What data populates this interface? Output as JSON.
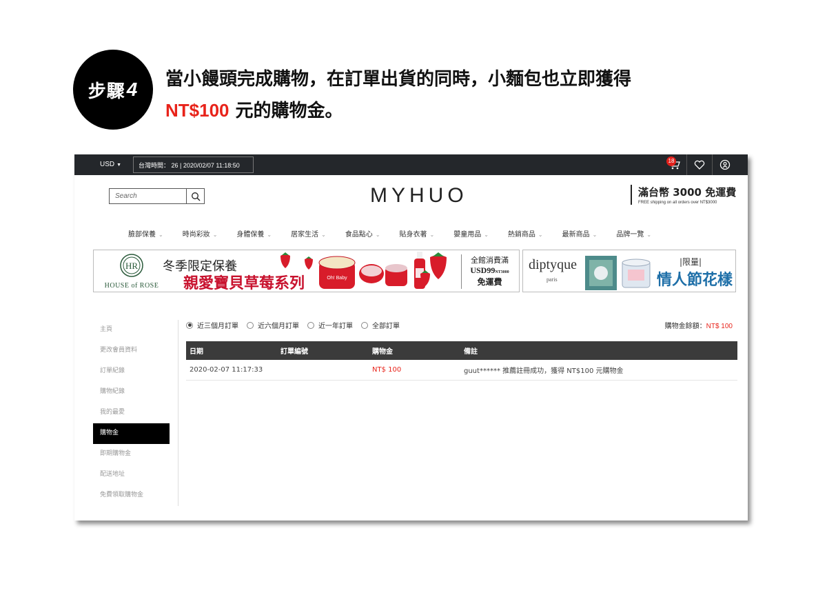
{
  "step": {
    "badge_text": "步驟",
    "badge_number": "4",
    "line1": "當小饅頭完成購物，在訂單出貨的同時，小麵包也立即獲得",
    "line2_highlight": "NT$100",
    "line2_rest": " 元的購物金。"
  },
  "topbar": {
    "currency": "USD",
    "clock": "台灣時間： 26 | 2020/02/07 11:18:50",
    "cart_count": "18",
    "icons": [
      "cart-icon",
      "heart-icon",
      "account-icon"
    ]
  },
  "header": {
    "search_placeholder": "Search",
    "logo": "MYHUO",
    "shipping_main": "滿台幣 3000 免運費",
    "shipping_sub": "FREE shipping on all orders over NT$3000"
  },
  "nav": {
    "items": [
      "臉部保養",
      "時尚彩妝",
      "身體保養",
      "居家生活",
      "食品點心",
      "貼身衣著",
      "嬰童用品",
      "熱銷商品",
      "最新商品",
      "品牌一覽"
    ]
  },
  "banners": {
    "house_rose": {
      "brand": "HOUSE of ROSE",
      "line1": "冬季限定保養",
      "line2": "親愛寶貝草莓系列",
      "promo_l1": "全館消費滿",
      "promo_l2": "USD99",
      "promo_l2_small": "NT3000",
      "promo_l3": "免運費",
      "jar_label": "Oh! Baby"
    },
    "diptyque": {
      "brand": "diptyque",
      "sub": "paris",
      "tag": "|限量|",
      "title": "情人節花樣"
    }
  },
  "sidebar": {
    "items": [
      "主頁",
      "更改會員資料",
      "訂單紀錄",
      "購物紀錄",
      "我的最愛",
      "購物金",
      "即期購物金",
      "配送地址",
      "免費領取購物金"
    ],
    "active_index": 5
  },
  "filters": {
    "options": [
      "近三個月訂單",
      "近六個月訂單",
      "近一年訂單",
      "全部訂單"
    ],
    "selected_index": 0
  },
  "balance": {
    "label": "購物金餘額：",
    "amount": "NT$ 100"
  },
  "table": {
    "headers": [
      "日期",
      "訂單編號",
      "購物金",
      "備註"
    ],
    "rows": [
      {
        "date": "2020-02-07 11:17:33",
        "order_no": "",
        "credit": "NT$ 100",
        "note": "guut****** 推薦註冊成功，獲得 NT$100 元購物金"
      }
    ]
  },
  "colors": {
    "highlight_red": "#e8231a",
    "topbar": "#24272b",
    "table_header": "#3b3b3b",
    "banner_red": "#c8122e",
    "banner_blue": "#1e6fa8"
  }
}
